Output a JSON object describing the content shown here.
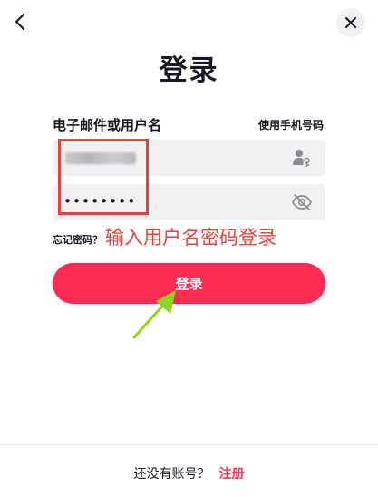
{
  "title": "登录",
  "form": {
    "username_label": "电子邮件或用户名",
    "alt_login_link": "使用手机号码",
    "password_value": "••••••••",
    "forgot_password": "忘记密码？",
    "login_button": "登录"
  },
  "annotation": {
    "text": "输入用户名密码登录",
    "color": "#e8403a",
    "arrow_color": "#8cd61e"
  },
  "footer": {
    "prompt": "还没有账号？",
    "signup_link": "注册"
  },
  "icons": {
    "back": "chevron-left-icon",
    "close": "close-icon",
    "user": "user-key-icon",
    "password_toggle": "eye-slash-icon"
  },
  "colors": {
    "primary": "#fe2c55",
    "input_bg": "#f1f1f2",
    "text": "#161823"
  }
}
